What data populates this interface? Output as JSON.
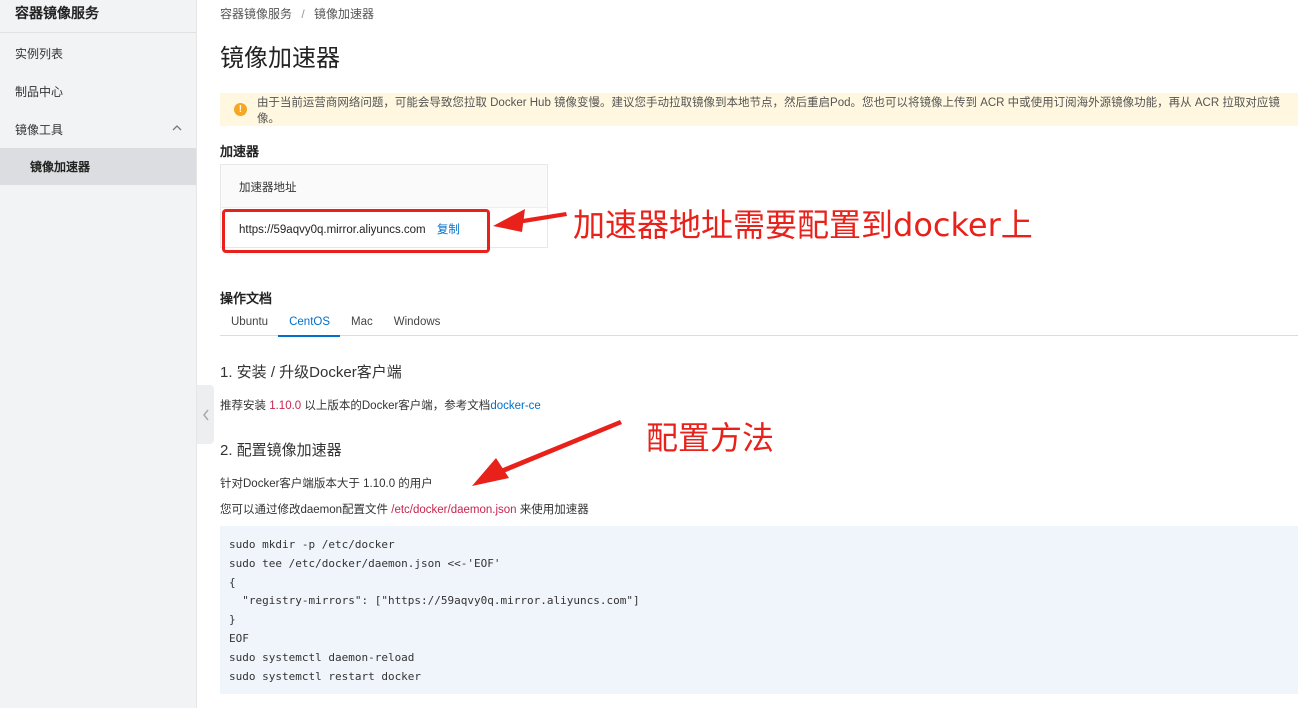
{
  "sidebar": {
    "title": "容器镜像服务",
    "items": [
      {
        "label": "实例列表"
      },
      {
        "label": "制品中心"
      },
      {
        "label": "镜像工具"
      }
    ],
    "sub_items": [
      {
        "label": "镜像加速器"
      }
    ]
  },
  "breadcrumb": {
    "root": "容器镜像服务",
    "separator": "/",
    "current": "镜像加速器"
  },
  "page_title": "镜像加速器",
  "alert": {
    "text": "由于当前运营商网络问题，可能会导致您拉取 Docker Hub 镜像变慢。建议您手动拉取镜像到本地节点，然后重启Pod。您也可以将镜像上传到 ACR 中或使用订阅海外源镜像功能，再从 ACR 拉取对应镜像。",
    "color": "#fff7e0"
  },
  "accelerator": {
    "section_title": "加速器",
    "column_header": "加速器地址",
    "address": "https://59aqvy0q.mirror.aliyuncs.com",
    "copy_label": "复制"
  },
  "docs": {
    "section_title": "操作文档",
    "tabs": [
      {
        "label": "Ubuntu",
        "active": false
      },
      {
        "label": "CentOS",
        "active": true
      },
      {
        "label": "Mac",
        "active": false
      },
      {
        "label": "Windows",
        "active": false
      }
    ],
    "step1": {
      "title": "1. 安装 / 升级Docker客户端",
      "text_prefix": "推荐安装 ",
      "version": "1.10.0",
      "text_middle": " 以上版本的Docker客户端，参考文档",
      "link": "docker-ce"
    },
    "step2": {
      "title": "2. 配置镜像加速器",
      "line1": "针对Docker客户端版本大于 1.10.0 的用户",
      "line2_prefix": "您可以通过修改daemon配置文件 ",
      "config_path": "/etc/docker/daemon.json",
      "line2_suffix": " 来使用加速器"
    },
    "code": [
      "sudo mkdir -p /etc/docker",
      "sudo tee /etc/docker/daemon.json <<-'EOF'",
      "{",
      "  \"registry-mirrors\": [\"https://59aqvy0q.mirror.aliyuncs.com\"]",
      "}",
      "EOF",
      "sudo systemctl daemon-reload",
      "sudo systemctl restart docker"
    ]
  },
  "annotations": {
    "note1": "加速器地址需要配置到docker上",
    "note2": "配置方法",
    "color": "#e8221b"
  },
  "icons": {
    "alert": "warning-icon",
    "collapse": "chevron-up-icon",
    "sidebar_toggle": "chevron-left-icon"
  },
  "colors": {
    "accent": "#0070cc",
    "highlight": "#c7254e",
    "code_bg": "#f0f5fb"
  }
}
